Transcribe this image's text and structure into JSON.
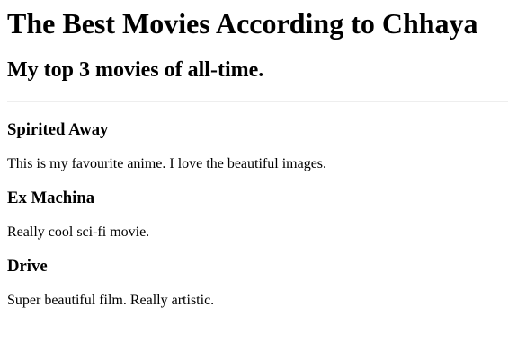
{
  "page": {
    "title": "The Best Movies According to Chhaya",
    "subtitle": "My top 3 movies of all-time."
  },
  "movies": [
    {
      "name": "Spirited Away",
      "description": "This is my favourite anime. I love the beautiful images."
    },
    {
      "name": "Ex Machina",
      "description": "Really cool sci-fi movie."
    },
    {
      "name": "Drive",
      "description": "Super beautiful film. Really artistic."
    }
  ]
}
